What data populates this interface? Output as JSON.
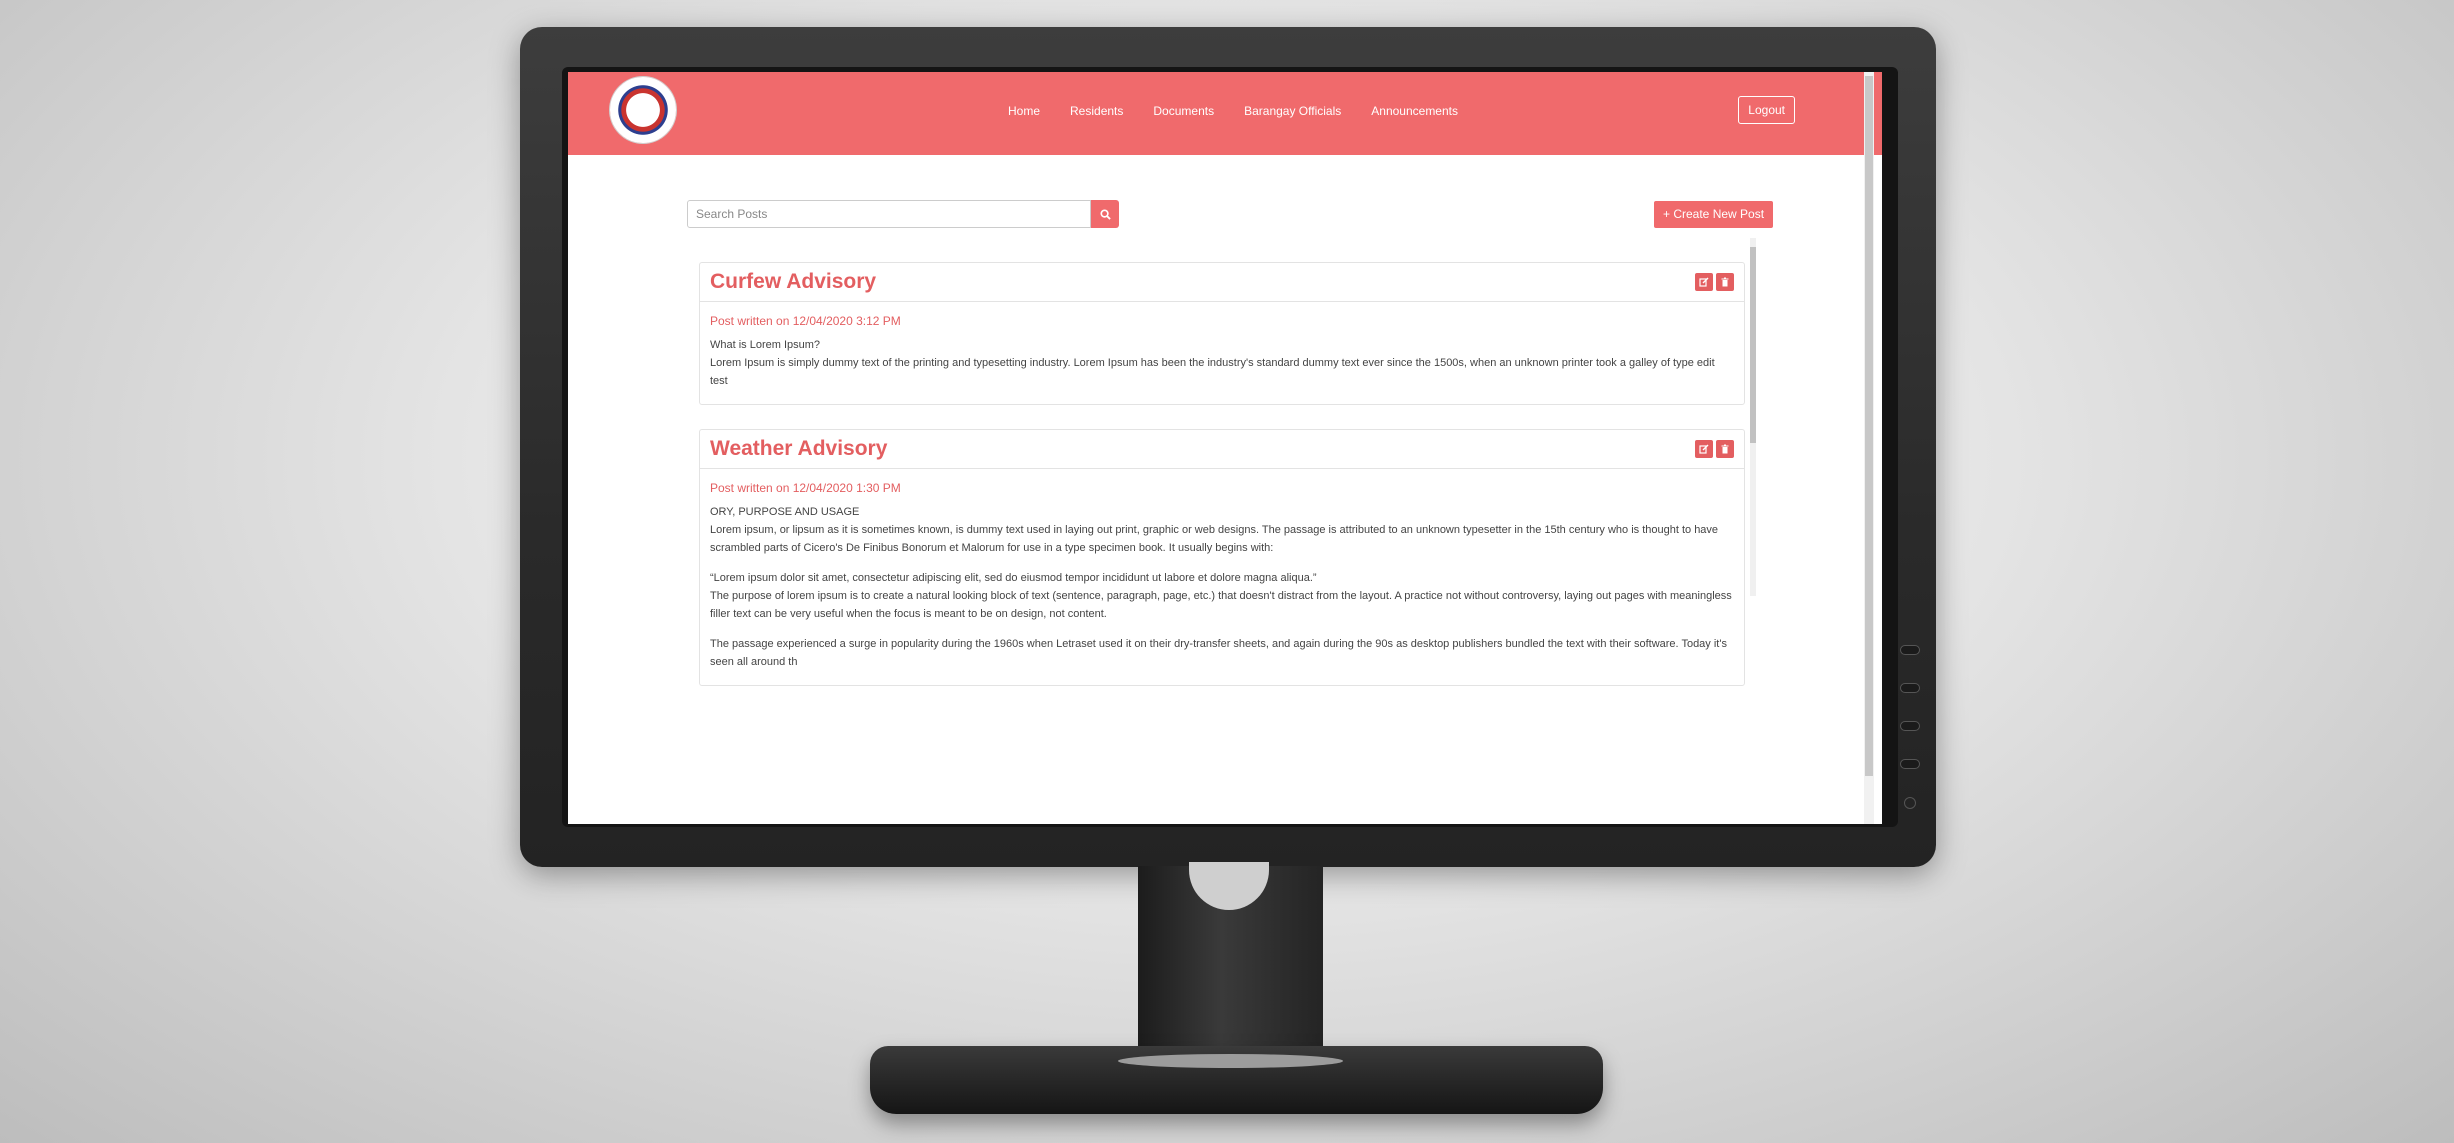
{
  "navbar": {
    "links": [
      "Home",
      "Residents",
      "Documents",
      "Barangay Officials",
      "Announcements"
    ],
    "logout_label": "Logout",
    "logo_icon": "barangay-seal-logo"
  },
  "search": {
    "placeholder": "Search Posts",
    "value": "",
    "button_icon": "search-icon"
  },
  "create_post_label": "+ Create New Post",
  "posts": [
    {
      "title": "Curfew Advisory",
      "meta": "Post written on 12/04/2020 3:12 PM",
      "lines": [
        "What is Lorem Ipsum?",
        "Lorem Ipsum is simply dummy text of the printing and typesetting industry. Lorem Ipsum has been the industry's standard dummy text ever since the 1500s, when an unknown printer took a galley of type edit",
        "test"
      ]
    },
    {
      "title": "Weather Advisory",
      "meta": "Post written on 12/04/2020 1:30 PM",
      "lines": [
        "ORY, PURPOSE AND USAGE",
        "Lorem ipsum, or lipsum as it is sometimes known, is dummy text used in laying out print, graphic or web designs. The passage is attributed to an unknown typesetter in the 15th century who is thought to have",
        "scrambled parts of Cicero's De Finibus Bonorum et Malorum for use in a type specimen book. It usually begins with:",
        "",
        "“Lorem ipsum dolor sit amet, consectetur adipiscing elit, sed do eiusmod tempor incididunt ut labore et dolore magna aliqua.”",
        "The purpose of lorem ipsum is to create a natural looking block of text (sentence, paragraph, page, etc.) that doesn't distract from the layout. A practice not without controversy, laying out pages with meaningless",
        "filler text can be very useful when the focus is meant to be on design, not content.",
        "",
        "The passage experienced a surge in popularity during the 1960s when Letraset used it on their dry-transfer sheets, and again during the 90s as desktop publishers bundled the text with their software. Today it's",
        "seen all around th"
      ]
    }
  ],
  "colors": {
    "accent": "#f06a6c",
    "title": "#e35e60"
  }
}
